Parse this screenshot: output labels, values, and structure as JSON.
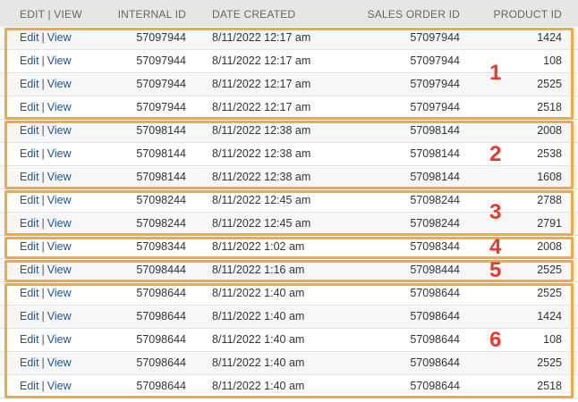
{
  "columns": {
    "edit_view": "EDIT | VIEW",
    "internal_id": "INTERNAL ID",
    "date_created": "DATE CREATED",
    "sales_order_id": "SALES ORDER ID",
    "product_id": "PRODUCT ID"
  },
  "links": {
    "edit": "Edit",
    "separator": "|",
    "view": "View"
  },
  "rows": [
    {
      "internal_id": "57097944",
      "date": "8/11/2022 12:17 am",
      "sales_order_id": "57097944",
      "product_id": "1424"
    },
    {
      "internal_id": "57097944",
      "date": "8/11/2022 12:17 am",
      "sales_order_id": "57097944",
      "product_id": "108"
    },
    {
      "internal_id": "57097944",
      "date": "8/11/2022 12:17 am",
      "sales_order_id": "57097944",
      "product_id": "2525"
    },
    {
      "internal_id": "57097944",
      "date": "8/11/2022 12:17 am",
      "sales_order_id": "57097944",
      "product_id": "2518"
    },
    {
      "internal_id": "57098144",
      "date": "8/11/2022 12:38 am",
      "sales_order_id": "57098144",
      "product_id": "2008"
    },
    {
      "internal_id": "57098144",
      "date": "8/11/2022 12:38 am",
      "sales_order_id": "57098144",
      "product_id": "2538"
    },
    {
      "internal_id": "57098144",
      "date": "8/11/2022 12:38 am",
      "sales_order_id": "57098144",
      "product_id": "1608"
    },
    {
      "internal_id": "57098244",
      "date": "8/11/2022 12:45 am",
      "sales_order_id": "57098244",
      "product_id": "2788"
    },
    {
      "internal_id": "57098244",
      "date": "8/11/2022 12:45 am",
      "sales_order_id": "57098244",
      "product_id": "2791"
    },
    {
      "internal_id": "57098344",
      "date": "8/11/2022 1:02 am",
      "sales_order_id": "57098344",
      "product_id": "2008"
    },
    {
      "internal_id": "57098444",
      "date": "8/11/2022 1:16 am",
      "sales_order_id": "57098444",
      "product_id": "2525"
    },
    {
      "internal_id": "57098644",
      "date": "8/11/2022 1:40 am",
      "sales_order_id": "57098644",
      "product_id": "2525"
    },
    {
      "internal_id": "57098644",
      "date": "8/11/2022 1:40 am",
      "sales_order_id": "57098644",
      "product_id": "1424"
    },
    {
      "internal_id": "57098644",
      "date": "8/11/2022 1:40 am",
      "sales_order_id": "57098644",
      "product_id": "108"
    },
    {
      "internal_id": "57098644",
      "date": "8/11/2022 1:40 am",
      "sales_order_id": "57098644",
      "product_id": "2525"
    },
    {
      "internal_id": "57098644",
      "date": "8/11/2022 1:40 am",
      "sales_order_id": "57098644",
      "product_id": "2518"
    }
  ],
  "groups": [
    {
      "label": "1",
      "row_count": 4
    },
    {
      "label": "2",
      "row_count": 3
    },
    {
      "label": "3",
      "row_count": 2
    },
    {
      "label": "4",
      "row_count": 1
    },
    {
      "label": "5",
      "row_count": 1
    },
    {
      "label": "6",
      "row_count": 5
    }
  ],
  "colors": {
    "link": "#22558e",
    "header_bg": "#e6e6e6",
    "highlight_box": "#f5a742",
    "group_label": "#e8392b"
  }
}
